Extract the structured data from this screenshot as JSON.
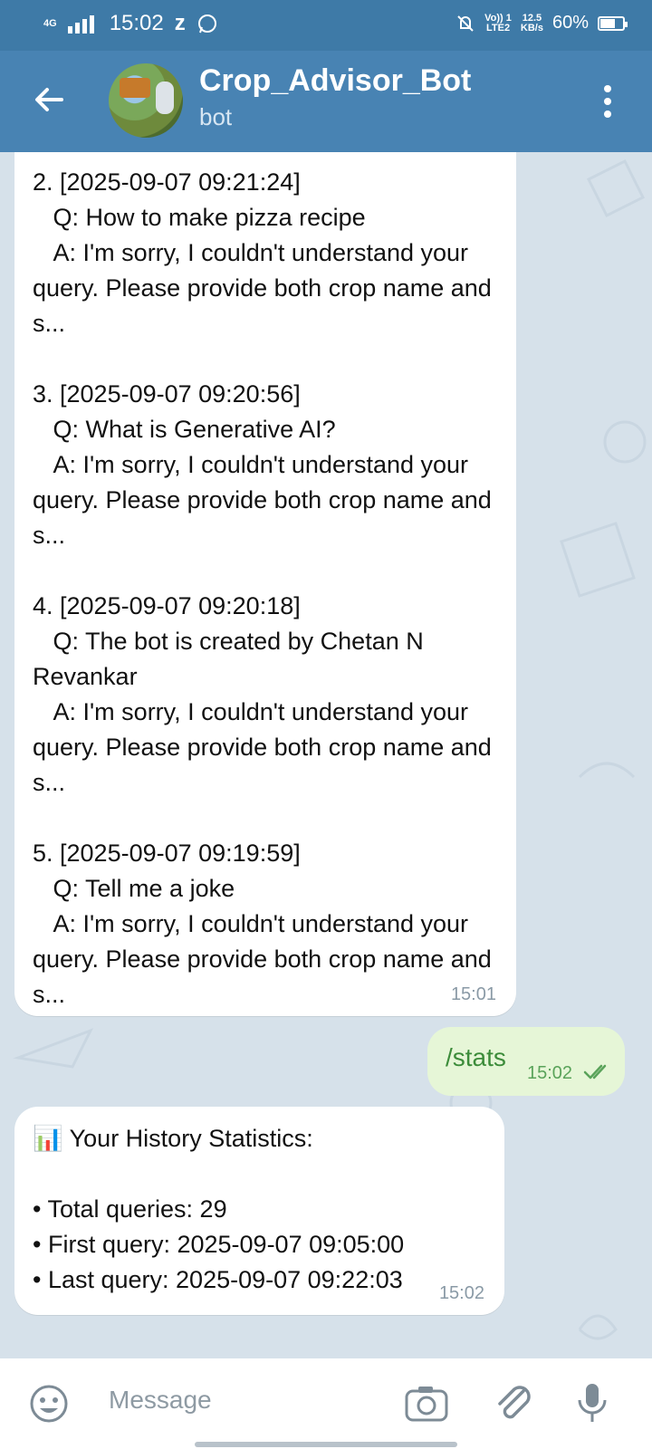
{
  "status_bar": {
    "network": "4G",
    "time": "15:02",
    "notif": "z",
    "volte": "Vo)) 1",
    "lte": "LTE2",
    "speed_value": "12.5",
    "speed_unit": "KB/s",
    "battery": "60%"
  },
  "header": {
    "title": "Crop_Advisor_Bot",
    "subtitle": "bot"
  },
  "messages": {
    "history": {
      "text": "2. [2025-09-07 09:21:24]\n   Q: How to make pizza recipe\n   A: I'm sorry, I couldn't understand your query. Please provide both crop name and s...\n\n3. [2025-09-07 09:20:56]\n   Q: What is Generative AI?\n   A: I'm sorry, I couldn't understand your query. Please provide both crop name and s...\n\n4. [2025-09-07 09:20:18]\n   Q: The bot is created by Chetan N Revankar\n   A: I'm sorry, I couldn't understand your query. Please provide both crop name and s...\n\n5. [2025-09-07 09:19:59]\n   Q: Tell me a joke\n   A: I'm sorry, I couldn't understand your query. Please provide both crop name and s...",
      "time": "15:01"
    },
    "outgoing": {
      "text": "/stats",
      "time": "15:02"
    },
    "stats": {
      "text": "📊 Your History Statistics:\n\n• Total queries: 29\n• First query: 2025-09-07 09:05:00\n• Last query: 2025-09-07 09:22:03",
      "time": "15:02"
    }
  },
  "input": {
    "placeholder": "Message"
  }
}
